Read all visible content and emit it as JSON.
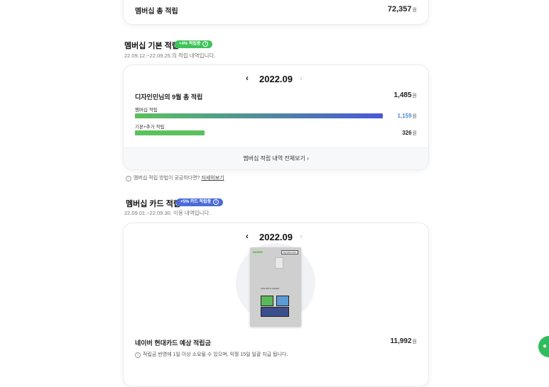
{
  "total": {
    "label": "멤버십 총 적립",
    "value": "72,357",
    "unit": "원"
  },
  "basic": {
    "title": "멤버십 기본 적립",
    "badge": "+4% 적립중",
    "period": "22.09.12.~22.09.25.의 적립 내역입니다.",
    "month": "2022.09",
    "row_title": "디자인민님의 9월 총 적립",
    "row_total": "1,485",
    "membership_label": "멤버십 적립",
    "membership_value": "1,159",
    "membership_progress": 1.0,
    "extra_label": "기본+추가 적립",
    "extra_value": "326",
    "extra_progress": 0.28,
    "footer": "멤버십 적립 내역 전체보기",
    "unit": "원"
  },
  "help": {
    "text": "멤버십 적립 방법이 궁금하다면?",
    "link": "자세히보기"
  },
  "cardsave": {
    "title": "멤버십 카드 적립",
    "badge": "+5% 카드 적립중",
    "period": "22.09.01.~22.09.30. 이용 내역입니다.",
    "month": "2022.09",
    "card_brand": "NAVER",
    "card_tag": "Hyundai Card",
    "card_text": "LIFE WITH NAVER",
    "row_title": "네이버 현대카드 예상 적립금",
    "row_value": "11,992",
    "unit": "원",
    "note": "적립금 반영에 1일 이상 소요될 수 있으며, 익월 15일 일괄 지급 됩니다."
  },
  "colors": {
    "green": "#3ec35a",
    "blue_badge": "#4a6bd8",
    "gradient_start": "#59c25c",
    "gradient_end": "#4a57d8",
    "membership_value": "#4a8bd8"
  }
}
